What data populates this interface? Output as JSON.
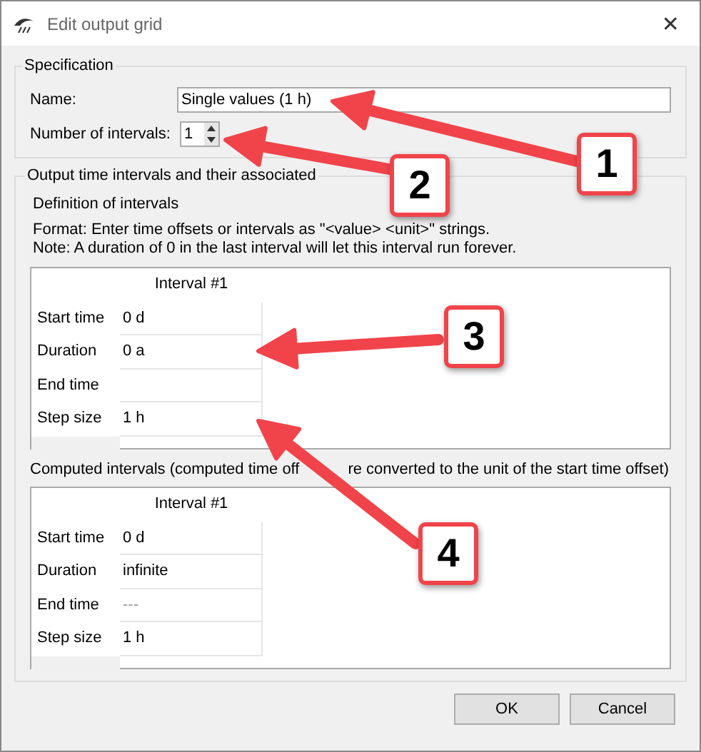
{
  "window": {
    "title": "Edit output grid",
    "close": "✕"
  },
  "specification": {
    "title": "Specification",
    "name_label": "Name:",
    "name_value": "Single values (1 h)",
    "intervals_label": "Number of intervals:",
    "intervals_value": "1"
  },
  "output": {
    "title": "Output time intervals and their associated",
    "definition": {
      "heading": "Definition of intervals",
      "notes": [
        "Format: Enter time offsets or intervals as \"<value> <unit>\" strings.",
        "Note: A duration of 0 in the last interval will let this interval run forever."
      ],
      "table": {
        "column": "Interval #1",
        "rows": [
          {
            "label": "Start time",
            "value": "0 d"
          },
          {
            "label": "Duration",
            "value": "0 a"
          },
          {
            "label": "End time"
          },
          {
            "label": "Step size",
            "value": "1 h"
          }
        ]
      }
    },
    "computed": {
      "heading": [
        "Computed intervals (computed time off",
        "re converted to the unit of the start time offset)"
      ],
      "table": {
        "column": "Interval #1",
        "rows": [
          {
            "label": "Start time",
            "value": "0 d",
            "muted": false
          },
          {
            "label": "Duration",
            "value": "infinite",
            "muted": false
          },
          {
            "label": "End time",
            "value": "---",
            "muted": true
          },
          {
            "label": "Step size",
            "value": "1 h",
            "muted": false
          }
        ]
      }
    }
  },
  "buttons": [
    "OK",
    "Cancel"
  ],
  "callouts": [
    "1",
    "2",
    "3",
    "4"
  ]
}
